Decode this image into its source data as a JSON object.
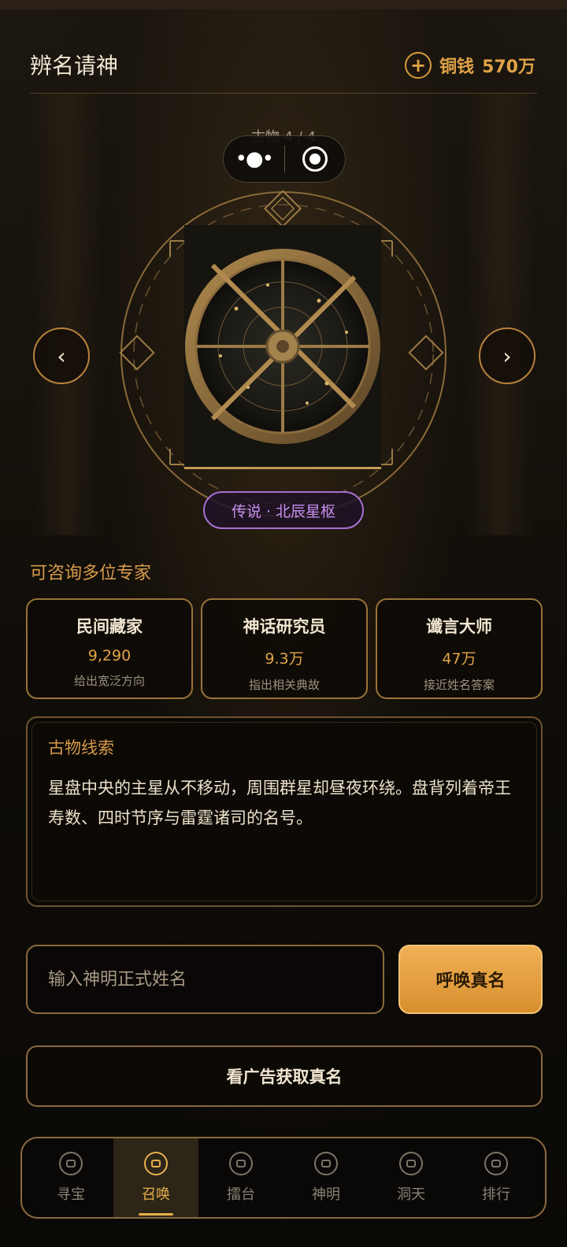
{
  "header": {
    "title": "辨名请神",
    "currency_label": "铜钱",
    "currency_value": "570万",
    "add_icon": "plus-circle-icon"
  },
  "capsule": {
    "more_icon": "more-dots-icon",
    "close_icon": "target-circle-icon"
  },
  "artifact": {
    "counter": "古物 4 / 4",
    "image_icon": "astrolabe-artifact",
    "rarity_label": "传说 · 北辰星枢",
    "prev_icon": "chevron-left-icon",
    "next_icon": "chevron-right-icon",
    "prev_glyph": "‹",
    "next_glyph": "›"
  },
  "experts_section": {
    "title": "可咨询多位专家",
    "items": [
      {
        "name": "民间藏家",
        "cost": "9,290",
        "desc": "给出宽泛方向"
      },
      {
        "name": "神话研究员",
        "cost": "9.3万",
        "desc": "指出相关典故"
      },
      {
        "name": "谶言大师",
        "cost": "47万",
        "desc": "接近姓名答案"
      }
    ]
  },
  "clue": {
    "title": "古物线索",
    "text": "星盘中央的主星从不移动，周围群星却昼夜环绕。盘背列着帝王寿数、四时节序与雷霆诸司的名号。"
  },
  "input": {
    "placeholder": "输入神明正式姓名",
    "value": ""
  },
  "summon_button": "呼唤真名",
  "ad_button": "看广告获取真名",
  "tabs": [
    {
      "label": "寻宝",
      "icon": "treasure-icon",
      "active": false
    },
    {
      "label": "召唤",
      "icon": "summon-icon",
      "active": true
    },
    {
      "label": "擂台",
      "icon": "arena-icon",
      "active": false
    },
    {
      "label": "神明",
      "icon": "deity-icon",
      "active": false
    },
    {
      "label": "洞天",
      "icon": "cave-icon",
      "active": false
    },
    {
      "label": "排行",
      "icon": "ranking-icon",
      "active": false
    }
  ],
  "colors": {
    "accent_gold": "#e2a547",
    "legend_purple": "#c78ff0",
    "background": "#0d0a07"
  }
}
